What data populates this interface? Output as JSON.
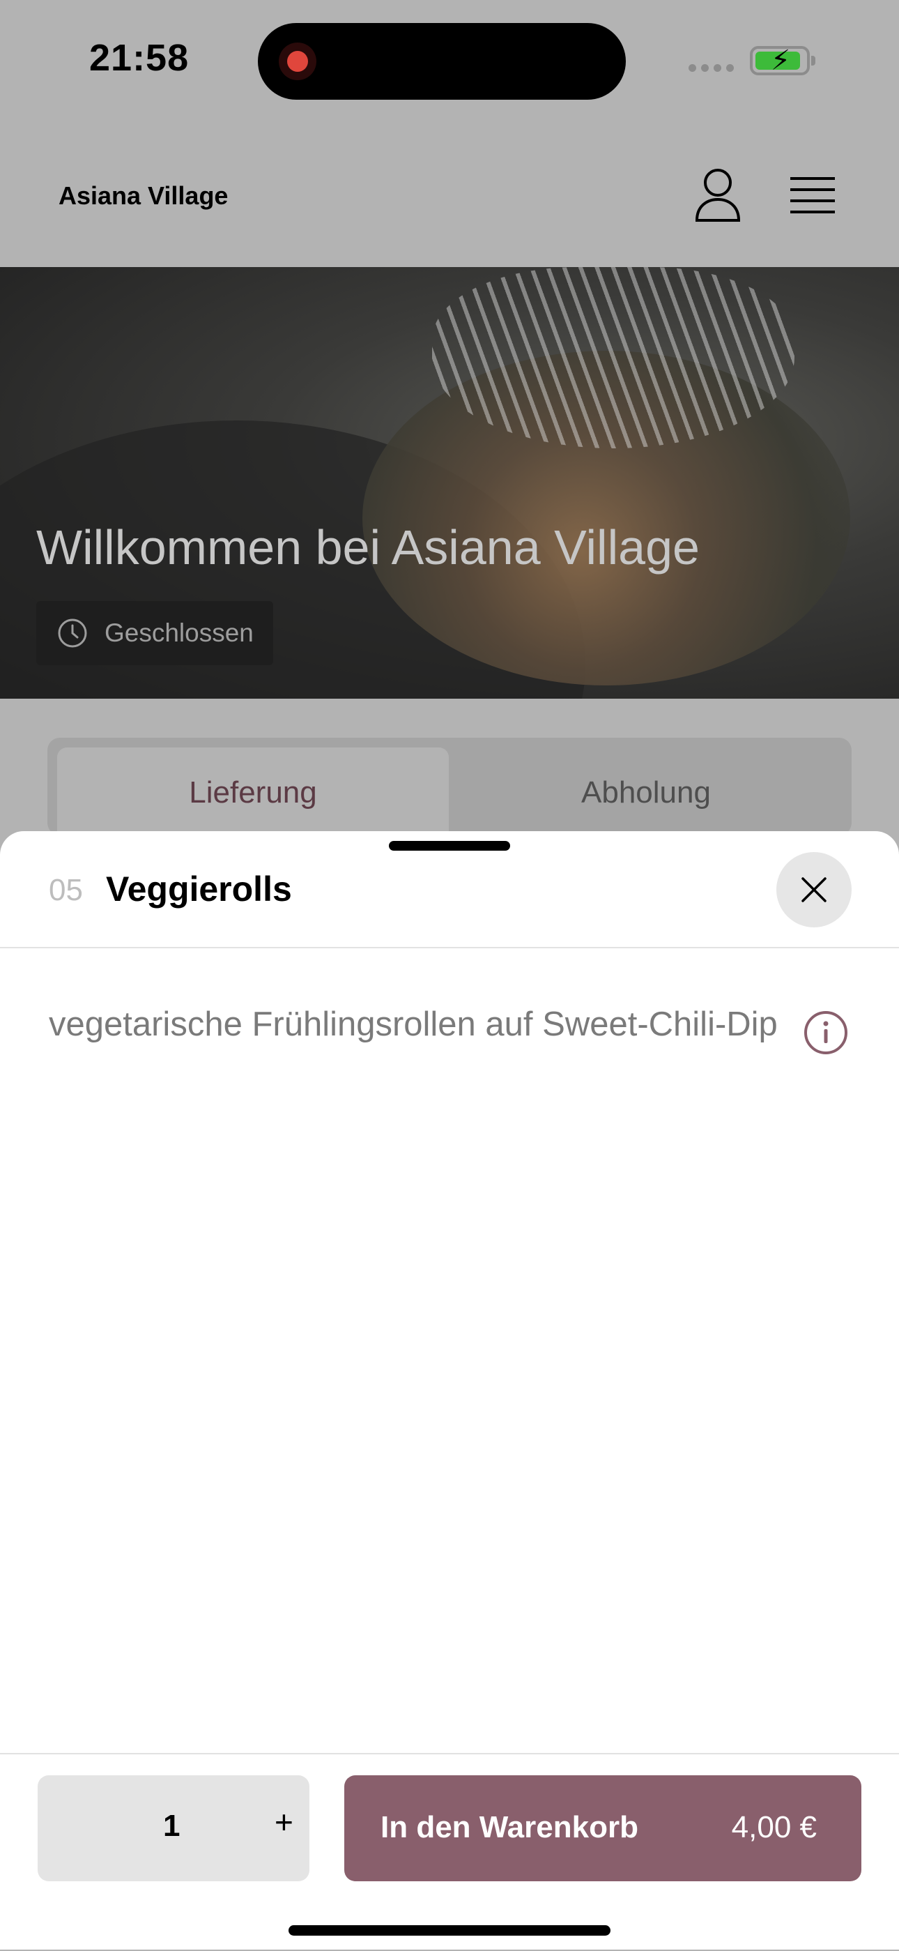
{
  "status_bar": {
    "time": "21:58"
  },
  "header": {
    "brand": "Asiana Village"
  },
  "hero": {
    "title": "Willkommen bei Asiana Village",
    "status": "Geschlossen"
  },
  "tabs": [
    {
      "label": "Lieferung",
      "active": true
    },
    {
      "label": "Abholung",
      "active": false
    }
  ],
  "sheet": {
    "item_number": "05",
    "item_name": "Veggierolls",
    "description": "vegetarische Frühlingsrollen auf Sweet-Chili-Dip"
  },
  "footer": {
    "quantity": "1",
    "plus_label": "+",
    "cart_label": "In den Warenkorb",
    "price": "4,00 €"
  },
  "colors": {
    "accent": "#895f6c",
    "tab_active_text": "#5b3a44"
  }
}
